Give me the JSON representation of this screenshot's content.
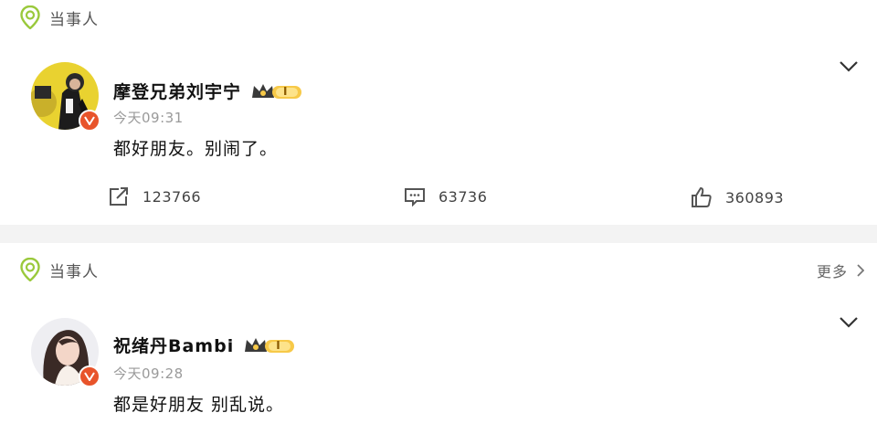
{
  "tag_label": "当事人",
  "posts": [
    {
      "username": "摩登兄弟刘宇宁",
      "vip_level": "I",
      "time": "今天09:31",
      "content": "都好朋友。别闹了。",
      "reposts": "123766",
      "comments": "63736",
      "likes": "360893"
    },
    {
      "username": "祝绪丹Bambi",
      "vip_level": "I",
      "time": "今天09:28",
      "content": "都是好朋友 别乱说。"
    }
  ],
  "more_label": "更多",
  "colors": {
    "accent_orange": "#f5a623",
    "vip_gold": "#f7c948",
    "verified_red": "#e8542b",
    "pin_green": "#9ac93c"
  }
}
